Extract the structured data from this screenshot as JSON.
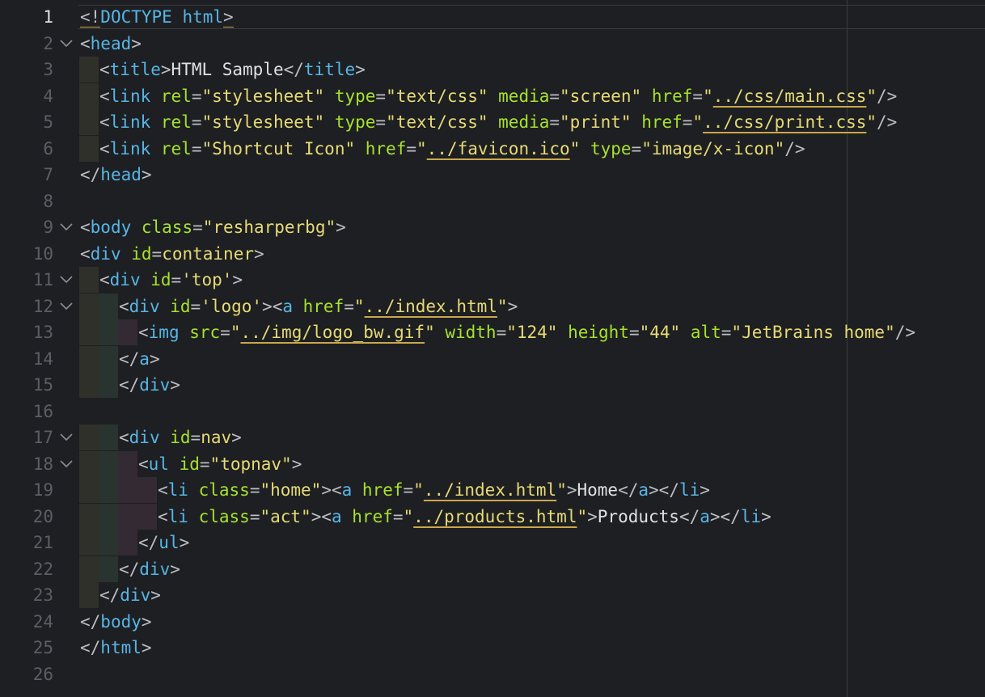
{
  "editor": {
    "language": "HTML",
    "current_line": 1
  },
  "lines": [
    {
      "n": "1",
      "indent": 0,
      "fold": false,
      "tokens": [
        [
          "b",
          "<!"
        ],
        [
          "t",
          "DOCTYPE html"
        ],
        [
          "b",
          ">"
        ]
      ]
    },
    {
      "n": "2",
      "indent": 0,
      "fold": true,
      "tokens": [
        [
          "b",
          "<"
        ],
        [
          "t",
          "head"
        ],
        [
          "b",
          ">"
        ]
      ]
    },
    {
      "n": "3",
      "indent": 1,
      "fold": false,
      "tokens": [
        [
          "b",
          "<"
        ],
        [
          "t",
          "title"
        ],
        [
          "b",
          ">"
        ],
        [
          "x",
          "HTML Sample"
        ],
        [
          "b",
          "</"
        ],
        [
          "t",
          "title"
        ],
        [
          "b",
          ">"
        ]
      ]
    },
    {
      "n": "4",
      "indent": 1,
      "fold": false,
      "tokens": [
        [
          "b",
          "<"
        ],
        [
          "t",
          "link "
        ],
        [
          "a",
          "rel"
        ],
        [
          "b",
          "="
        ],
        [
          "v",
          "\"stylesheet\" "
        ],
        [
          "a",
          "type"
        ],
        [
          "b",
          "="
        ],
        [
          "v",
          "\"text/css\" "
        ],
        [
          "a",
          "media"
        ],
        [
          "b",
          "="
        ],
        [
          "v",
          "\"screen\" "
        ],
        [
          "a",
          "href"
        ],
        [
          "b",
          "="
        ],
        [
          "v",
          "\""
        ],
        [
          "u",
          "../css/main.css"
        ],
        [
          "v",
          "\""
        ],
        [
          "b",
          "/>"
        ]
      ]
    },
    {
      "n": "5",
      "indent": 1,
      "fold": false,
      "tokens": [
        [
          "b",
          "<"
        ],
        [
          "t",
          "link "
        ],
        [
          "a",
          "rel"
        ],
        [
          "b",
          "="
        ],
        [
          "v",
          "\"stylesheet\" "
        ],
        [
          "a",
          "type"
        ],
        [
          "b",
          "="
        ],
        [
          "v",
          "\"text/css\" "
        ],
        [
          "a",
          "media"
        ],
        [
          "b",
          "="
        ],
        [
          "v",
          "\"print\" "
        ],
        [
          "a",
          "href"
        ],
        [
          "b",
          "="
        ],
        [
          "v",
          "\""
        ],
        [
          "u",
          "../css/print.css"
        ],
        [
          "v",
          "\""
        ],
        [
          "b",
          "/>"
        ]
      ]
    },
    {
      "n": "6",
      "indent": 1,
      "fold": false,
      "tokens": [
        [
          "b",
          "<"
        ],
        [
          "t",
          "link "
        ],
        [
          "a",
          "rel"
        ],
        [
          "b",
          "="
        ],
        [
          "v",
          "\"Shortcut Icon\" "
        ],
        [
          "a",
          "href"
        ],
        [
          "b",
          "="
        ],
        [
          "v",
          "\""
        ],
        [
          "u",
          "../favicon.ico"
        ],
        [
          "v",
          "\" "
        ],
        [
          "a",
          "type"
        ],
        [
          "b",
          "="
        ],
        [
          "v",
          "\"image/x-icon\""
        ],
        [
          "b",
          "/>"
        ]
      ]
    },
    {
      "n": "7",
      "indent": 0,
      "fold": false,
      "tokens": [
        [
          "b",
          "</"
        ],
        [
          "t",
          "head"
        ],
        [
          "b",
          ">"
        ]
      ]
    },
    {
      "n": "8",
      "indent": 0,
      "fold": false,
      "tokens": []
    },
    {
      "n": "9",
      "indent": 0,
      "fold": true,
      "tokens": [
        [
          "b",
          "<"
        ],
        [
          "t",
          "body "
        ],
        [
          "a",
          "class"
        ],
        [
          "b",
          "="
        ],
        [
          "v",
          "\"resharperbg\""
        ],
        [
          "b",
          ">"
        ]
      ]
    },
    {
      "n": "10",
      "indent": 0,
      "fold": false,
      "tokens": [
        [
          "b",
          "<"
        ],
        [
          "t",
          "div "
        ],
        [
          "a",
          "id"
        ],
        [
          "b",
          "="
        ],
        [
          "v",
          "container"
        ],
        [
          "b",
          ">"
        ]
      ]
    },
    {
      "n": "11",
      "indent": 1,
      "fold": true,
      "tokens": [
        [
          "b",
          "<"
        ],
        [
          "t",
          "div "
        ],
        [
          "a",
          "id"
        ],
        [
          "b",
          "="
        ],
        [
          "v",
          "'top'"
        ],
        [
          "b",
          ">"
        ]
      ]
    },
    {
      "n": "12",
      "indent": 2,
      "fold": true,
      "tokens": [
        [
          "b",
          "<"
        ],
        [
          "t",
          "div "
        ],
        [
          "a",
          "id"
        ],
        [
          "b",
          "="
        ],
        [
          "v",
          "'logo'"
        ],
        [
          "b",
          "><"
        ],
        [
          "t",
          "a "
        ],
        [
          "a",
          "href"
        ],
        [
          "b",
          "="
        ],
        [
          "v",
          "\""
        ],
        [
          "u",
          "../index.html"
        ],
        [
          "v",
          "\""
        ],
        [
          "b",
          ">"
        ]
      ]
    },
    {
      "n": "13",
      "indent": 3,
      "fold": false,
      "tokens": [
        [
          "b",
          "<"
        ],
        [
          "t",
          "img "
        ],
        [
          "a",
          "src"
        ],
        [
          "b",
          "="
        ],
        [
          "v",
          "\""
        ],
        [
          "u",
          "../img/logo_bw.gif"
        ],
        [
          "v",
          "\" "
        ],
        [
          "a",
          "width"
        ],
        [
          "b",
          "="
        ],
        [
          "v",
          "\"124\" "
        ],
        [
          "a",
          "height"
        ],
        [
          "b",
          "="
        ],
        [
          "v",
          "\"44\" "
        ],
        [
          "a",
          "alt"
        ],
        [
          "b",
          "="
        ],
        [
          "v",
          "\"JetBrains home\""
        ],
        [
          "b",
          "/>"
        ]
      ]
    },
    {
      "n": "14",
      "indent": 2,
      "fold": false,
      "tokens": [
        [
          "b",
          "</"
        ],
        [
          "t",
          "a"
        ],
        [
          "b",
          ">"
        ]
      ]
    },
    {
      "n": "15",
      "indent": 2,
      "fold": false,
      "tokens": [
        [
          "b",
          "</"
        ],
        [
          "t",
          "div"
        ],
        [
          "b",
          ">"
        ]
      ]
    },
    {
      "n": "16",
      "indent": 0,
      "fold": false,
      "tokens": []
    },
    {
      "n": "17",
      "indent": 2,
      "fold": true,
      "tokens": [
        [
          "b",
          "<"
        ],
        [
          "t",
          "div "
        ],
        [
          "a",
          "id"
        ],
        [
          "b",
          "="
        ],
        [
          "v",
          "nav"
        ],
        [
          "b",
          ">"
        ]
      ]
    },
    {
      "n": "18",
      "indent": 3,
      "fold": true,
      "tokens": [
        [
          "b",
          "<"
        ],
        [
          "t",
          "ul "
        ],
        [
          "a",
          "id"
        ],
        [
          "b",
          "="
        ],
        [
          "v",
          "\"topnav\""
        ],
        [
          "b",
          ">"
        ]
      ]
    },
    {
      "n": "19",
      "indent": 4,
      "fold": false,
      "tokens": [
        [
          "b",
          "<"
        ],
        [
          "t",
          "li "
        ],
        [
          "a",
          "class"
        ],
        [
          "b",
          "="
        ],
        [
          "v",
          "\"home\""
        ],
        [
          "b",
          "><"
        ],
        [
          "t",
          "a "
        ],
        [
          "a",
          "href"
        ],
        [
          "b",
          "="
        ],
        [
          "v",
          "\""
        ],
        [
          "u",
          "../index.html"
        ],
        [
          "v",
          "\""
        ],
        [
          "b",
          ">"
        ],
        [
          "x",
          "Home"
        ],
        [
          "b",
          "</"
        ],
        [
          "t",
          "a"
        ],
        [
          "b",
          "></"
        ],
        [
          "t",
          "li"
        ],
        [
          "b",
          ">"
        ]
      ]
    },
    {
      "n": "20",
      "indent": 4,
      "fold": false,
      "tokens": [
        [
          "b",
          "<"
        ],
        [
          "t",
          "li "
        ],
        [
          "a",
          "class"
        ],
        [
          "b",
          "="
        ],
        [
          "v",
          "\"act\""
        ],
        [
          "b",
          "><"
        ],
        [
          "t",
          "a "
        ],
        [
          "a",
          "href"
        ],
        [
          "b",
          "="
        ],
        [
          "v",
          "\""
        ],
        [
          "u",
          "../products.html"
        ],
        [
          "v",
          "\""
        ],
        [
          "b",
          ">"
        ],
        [
          "x",
          "Products"
        ],
        [
          "b",
          "</"
        ],
        [
          "t",
          "a"
        ],
        [
          "b",
          "></"
        ],
        [
          "t",
          "li"
        ],
        [
          "b",
          ">"
        ]
      ]
    },
    {
      "n": "21",
      "indent": 3,
      "fold": false,
      "tokens": [
        [
          "b",
          "</"
        ],
        [
          "t",
          "ul"
        ],
        [
          "b",
          ">"
        ]
      ]
    },
    {
      "n": "22",
      "indent": 2,
      "fold": false,
      "tokens": [
        [
          "b",
          "</"
        ],
        [
          "t",
          "div"
        ],
        [
          "b",
          ">"
        ]
      ]
    },
    {
      "n": "23",
      "indent": 1,
      "fold": false,
      "tokens": [
        [
          "b",
          "</"
        ],
        [
          "t",
          "div"
        ],
        [
          "b",
          ">"
        ]
      ]
    },
    {
      "n": "24",
      "indent": 0,
      "fold": false,
      "tokens": [
        [
          "b",
          "</"
        ],
        [
          "t",
          "body"
        ],
        [
          "b",
          ">"
        ]
      ]
    },
    {
      "n": "25",
      "indent": 0,
      "fold": false,
      "tokens": [
        [
          "b",
          "</"
        ],
        [
          "t",
          "html"
        ],
        [
          "b",
          ">"
        ]
      ]
    },
    {
      "n": "26",
      "indent": 0,
      "fold": false,
      "tokens": []
    }
  ],
  "icons": {
    "fold": "chevron-down-icon"
  }
}
